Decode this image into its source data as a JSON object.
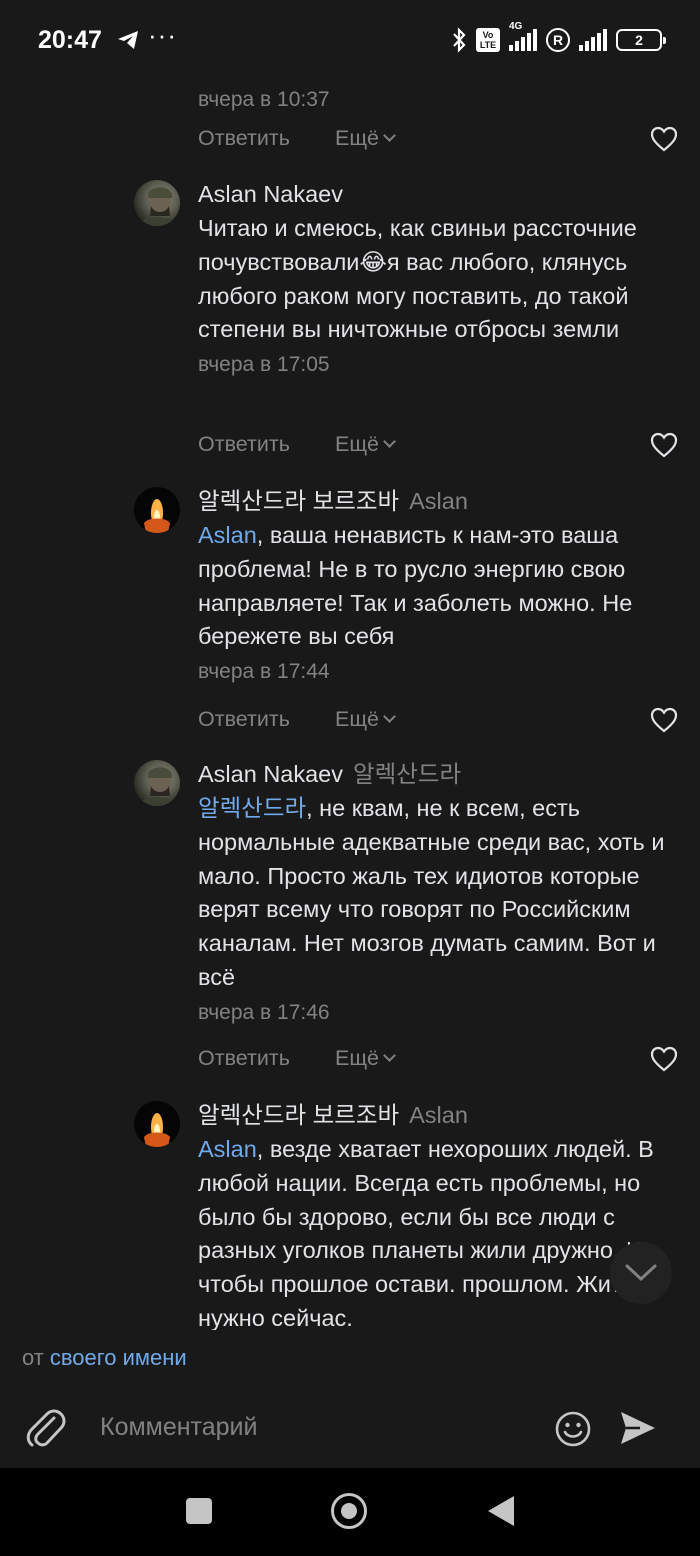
{
  "status_bar": {
    "time": "20:47",
    "dots": "···",
    "volte": "Vo LTE",
    "network": "4G",
    "roaming": "R",
    "battery": "2"
  },
  "partial_text": "...",
  "comments": [
    {
      "author": "",
      "reply_to": "",
      "mention": "",
      "text": "",
      "time": "вчера в 10:37",
      "reply_label": "Ответить",
      "more_label": "Ещё"
    },
    {
      "author": "Aslan Nakaev",
      "reply_to": "",
      "mention": "",
      "text": "Читаю и смеюсь, как свиньи расс­точние почувствовали😂я вас любого, клянусь любого раком могу поставить, до такой степени вы ничтожные отбросы земли",
      "time": "вчера в 17:05",
      "reply_label": "Ответить",
      "more_label": "Ещё"
    },
    {
      "author": "알렉산드라 보르조바",
      "reply_to": "Aslan",
      "mention": "Aslan",
      "text": ", ваша ненависть к нам-это ваша проблема! Не в то русло энергию свою направляете! Так и заболеть можно. Не бережете вы себя",
      "time": "вчера в 17:44",
      "reply_label": "Ответить",
      "more_label": "Ещё"
    },
    {
      "author": "Aslan Nakaev",
      "reply_to": "알렉산드라",
      "mention": "알렉산드라",
      "text": ", не квам, не к всем, есть нормальные адекватные среди вас, хоть и мало. Просто жаль тех идиотов которые верят всему что говорят по Российским каналам. Нет мозгов думать самим. Вот и всё",
      "time": "вчера в 17:46",
      "reply_label": "Ответить",
      "more_label": "Ещё"
    },
    {
      "author": "알렉산드라 보르조바",
      "reply_to": "Aslan",
      "mention": "Aslan",
      "text": ", везде хватает нехороших людей. В любой нации. Всегда есть проблемы, но было бы здорово, если бы все люди с разных уголков планеты жили дружно. И чтобы прошлое остави. прошлом. Жить нужно сейчас.",
      "time": "",
      "reply_label": "",
      "more_label": ""
    }
  ],
  "footer": {
    "from_prefix": "от",
    "from_link": "своего имени",
    "comment_placeholder": "Комментарий"
  },
  "colors": {
    "background": "#19191a",
    "text": "#e1e3e6",
    "secondary": "#828282",
    "accent": "#71aaeb"
  },
  "icons": {
    "telegram": "telegram-icon",
    "bluetooth": "bluetooth-icon",
    "attach": "paperclip-icon",
    "emoji": "smile-icon",
    "send": "send-icon",
    "like": "heart-icon",
    "scroll": "chevron-down-icon"
  }
}
